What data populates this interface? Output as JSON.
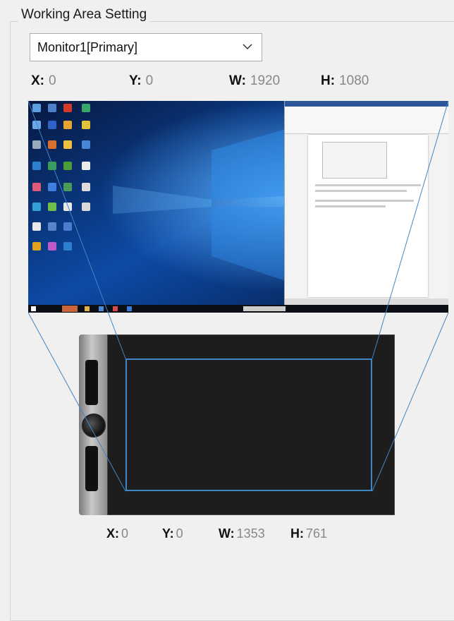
{
  "group_title": "Working Area Setting",
  "monitor_select": {
    "selected": "Monitor1[Primary]"
  },
  "screen_area": {
    "x_label": "X:",
    "x": "0",
    "y_label": "Y:",
    "y": "0",
    "w_label": "W:",
    "w": "1920",
    "h_label": "H:",
    "h": "1080"
  },
  "tablet_area": {
    "x_label": "X:",
    "x": "0",
    "y_label": "Y:",
    "y": "0",
    "w_label": "W:",
    "w": "1353",
    "h_label": "H:",
    "h": "761"
  },
  "colors": {
    "mapping_line": "#3f86c6",
    "tablet_body": "#1d1d1d"
  }
}
